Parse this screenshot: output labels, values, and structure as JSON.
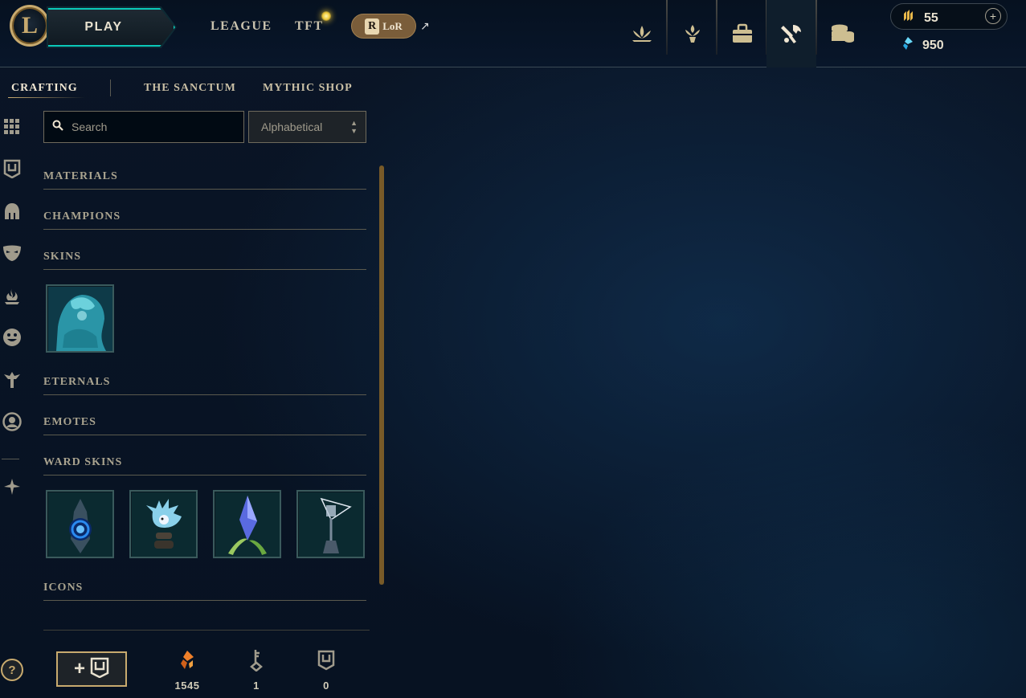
{
  "topnav": {
    "logo_letter": "L",
    "play_label": "PLAY",
    "links": [
      "LEAGUE",
      "TFT"
    ],
    "lor_badge": "LoR",
    "external_arrow": "↗",
    "right_icons": [
      "lotus-icon",
      "challenge-icon",
      "collection-icon",
      "crafting-icon",
      "store-icon"
    ],
    "active_icon": "crafting-icon"
  },
  "wallet": {
    "rp": "55",
    "blue_essence": "950",
    "add_label": "+"
  },
  "subnav": {
    "tabs": [
      "CRAFTING",
      "THE SANCTUM",
      "MYTHIC SHOP"
    ],
    "active": "CRAFTING"
  },
  "rail_icons": [
    "grid-icon",
    "chest-icon",
    "helmet-icon",
    "mask-icon",
    "flame-icon",
    "emote-icon",
    "ward-icon",
    "profile-icon",
    "key-fragment-icon"
  ],
  "search": {
    "placeholder": "Search"
  },
  "sort": {
    "value": "Alphabetical"
  },
  "categories": {
    "materials": "MATERIALS",
    "champions": "CHAMPIONS",
    "skins": "SKINS",
    "eternals": "ETERNALS",
    "emotes": "EMOTES",
    "ward_skins": "WARD SKINS",
    "icons": "ICONS"
  },
  "skins_items": [
    "skin-shard"
  ],
  "ward_items": [
    "ward-skin-portal",
    "ward-skin-poro",
    "ward-skin-crystal",
    "ward-skin-lantern"
  ],
  "footer": {
    "help_label": "?",
    "orange_essence": "1545",
    "keys": "1",
    "chests": "0"
  },
  "colors": {
    "gold": "#c8aa6e",
    "teal": "#0ac8b9",
    "orange": "#f0802a",
    "blue": "#2ac8f0"
  }
}
